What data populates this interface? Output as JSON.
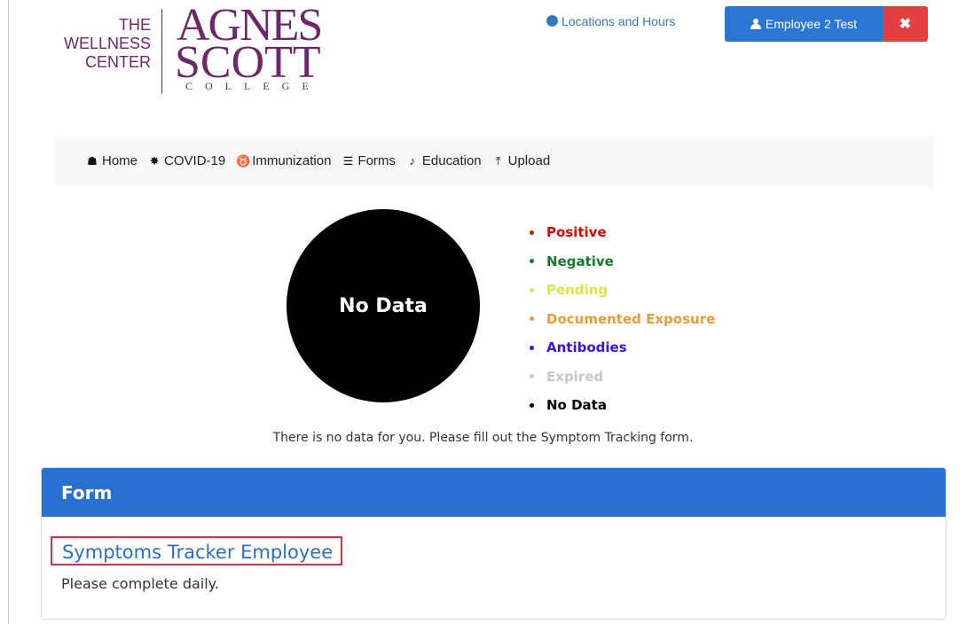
{
  "logo": {
    "left_lines": [
      "THE",
      "WELLNESS",
      "CENTER"
    ],
    "agnes": "AGNES",
    "scott": "SCOTT",
    "college": "COLLEGE"
  },
  "header": {
    "locations_link": "Locations and Hours",
    "user_button": "Employee 2 Test",
    "close_button": "✖"
  },
  "nav": {
    "items": [
      {
        "label": "Home",
        "icon": "home-icon",
        "glyph": "🏠"
      },
      {
        "label": "COVID-19",
        "icon": "virus-icon",
        "glyph": "✸"
      },
      {
        "label": "Immunization",
        "icon": "stethoscope-icon",
        "glyph": "♉"
      },
      {
        "label": "Forms",
        "icon": "list-icon",
        "glyph": "☰"
      },
      {
        "label": "Education",
        "icon": "bell-icon",
        "glyph": "🔔"
      },
      {
        "label": "Upload",
        "icon": "upload-icon",
        "glyph": "⤒"
      }
    ]
  },
  "status": {
    "circle_label": "No Data",
    "legend": [
      {
        "label": "Positive",
        "color": "#e00000"
      },
      {
        "label": "Negative",
        "color": "#137b2b"
      },
      {
        "label": "Pending",
        "color": "#d8e84a"
      },
      {
        "label": "Documented Exposure",
        "color": "#e99b3a"
      },
      {
        "label": "Antibodies",
        "color": "#3a12e8"
      },
      {
        "label": "Expired",
        "color": "#c8c8c8"
      },
      {
        "label": "No Data",
        "color": "#000000"
      }
    ],
    "note": "There is no data for you. Please fill out the Symptom Tracking form."
  },
  "form_panel": {
    "title": "Form",
    "link": "Symptoms Tracker Employee",
    "description": "Please complete daily."
  }
}
